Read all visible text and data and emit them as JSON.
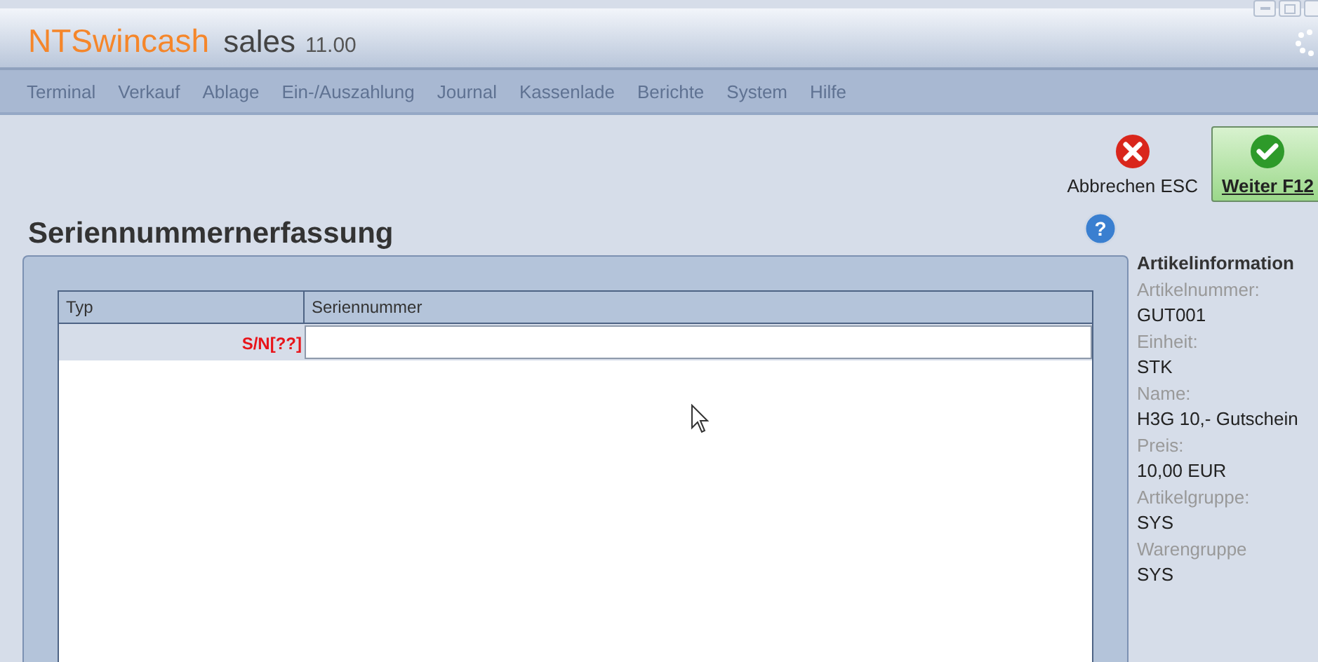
{
  "app": {
    "brand": "NTSwincash",
    "product": "sales",
    "version": "11.00"
  },
  "menu": [
    {
      "label": "Terminal",
      "disabled": true
    },
    {
      "label": "Verkauf",
      "disabled": true
    },
    {
      "label": "Ablage",
      "disabled": true
    },
    {
      "label": "Ein-/Auszahlung",
      "disabled": true
    },
    {
      "label": "Journal",
      "disabled": true
    },
    {
      "label": "Kassenlade",
      "disabled": true
    },
    {
      "label": "Berichte",
      "disabled": true
    },
    {
      "label": "System",
      "disabled": true
    },
    {
      "label": "Hilfe",
      "disabled": true
    }
  ],
  "actions": [
    {
      "kind": "cancel",
      "label": "Abbrechen ESC"
    },
    {
      "kind": "confirm",
      "label": "Weiter F12"
    }
  ],
  "page_title": "Seriennummernerfassung",
  "help_glyph": "?",
  "table": {
    "columns": [
      "Typ",
      "Seriennummer"
    ],
    "rows": [
      {
        "type": "S/N[??]",
        "serial": ""
      }
    ]
  },
  "info": {
    "title": "Artikelinformation",
    "fields": [
      {
        "label": "Artikelnummer:",
        "value": "GUT001"
      },
      {
        "label": "Einheit:",
        "value": "STK"
      },
      {
        "label": "Name:",
        "value": "H3G 10,- Gutschein"
      },
      {
        "label": "Preis:",
        "value": "10,00 EUR"
      },
      {
        "label": "Artikelgruppe:",
        "value": "SYS"
      },
      {
        "label": "Warengruppe",
        "value": "SYS"
      }
    ]
  }
}
